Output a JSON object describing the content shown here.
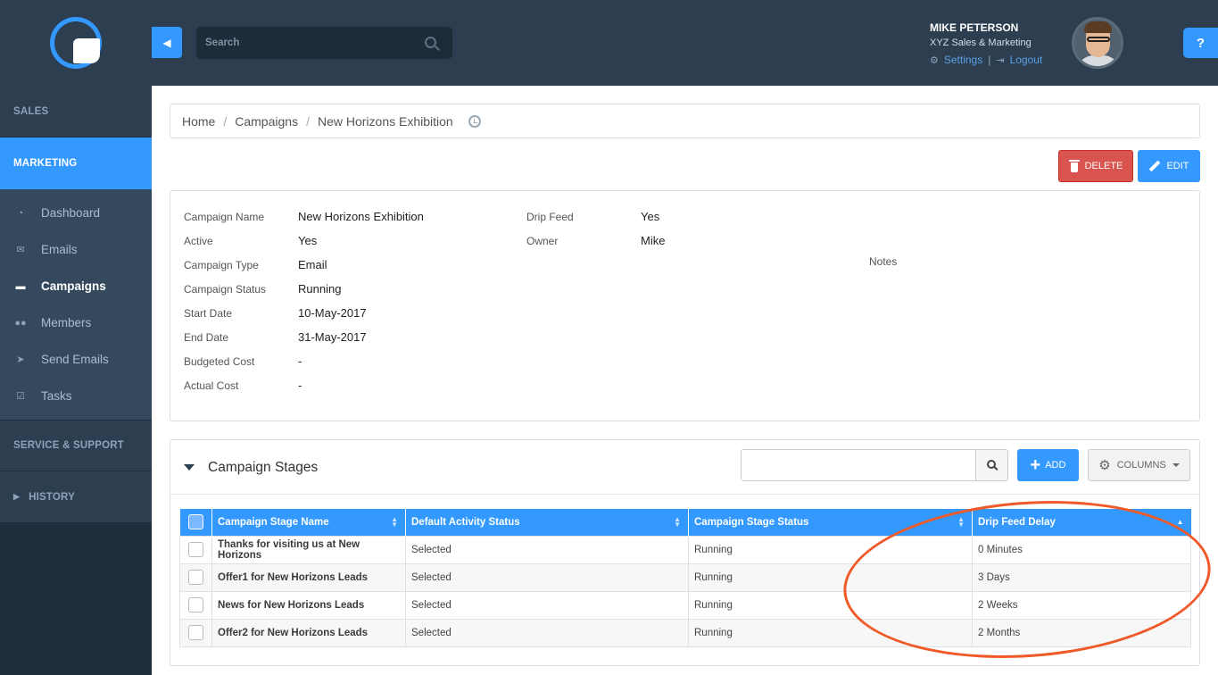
{
  "sidebar": {
    "sections": {
      "sales": "SALES",
      "marketing": "MARKETING",
      "service": "SERVICE & SUPPORT",
      "history": "HISTORY"
    },
    "marketing_items": [
      {
        "label": "Dashboard",
        "icon": "dashboard-icon"
      },
      {
        "label": "Emails",
        "icon": "envelope-icon"
      },
      {
        "label": "Campaigns",
        "icon": "inbox-icon"
      },
      {
        "label": "Members",
        "icon": "users-icon"
      },
      {
        "label": "Send Emails",
        "icon": "paper-plane-icon"
      },
      {
        "label": "Tasks",
        "icon": "check-square-icon"
      }
    ],
    "current": "Campaigns"
  },
  "topbar": {
    "search_placeholder": "Search",
    "user": {
      "name": "MIKE PETERSON",
      "company": "XYZ Sales & Marketing",
      "settings": "Settings",
      "logout": "Logout"
    },
    "help": "?"
  },
  "breadcrumb": [
    "Home",
    "Campaigns",
    "New Horizons Exhibition"
  ],
  "actions": {
    "delete": "DELETE",
    "edit": "EDIT"
  },
  "details": {
    "left": [
      {
        "label": "Campaign Name",
        "value": "New Horizons Exhibition"
      },
      {
        "label": "Active",
        "value": "Yes"
      },
      {
        "label": "Campaign Type",
        "value": "Email"
      },
      {
        "label": "Campaign Status",
        "value": "Running"
      },
      {
        "label": "Start Date",
        "value": "10-May-2017"
      },
      {
        "label": "End Date",
        "value": "31-May-2017"
      },
      {
        "label": "Budgeted Cost",
        "value": "-"
      },
      {
        "label": "Actual Cost",
        "value": "-"
      }
    ],
    "right": [
      {
        "label": "Drip Feed",
        "value": "Yes"
      },
      {
        "label": "Owner",
        "value": "Mike"
      }
    ],
    "notes_label": "Notes"
  },
  "stages": {
    "title": "Campaign Stages",
    "add": "ADD",
    "columns": "COLUMNS",
    "headers": [
      "Campaign Stage Name",
      "Default Activity Status",
      "Campaign Stage Status",
      "Drip Feed Delay"
    ],
    "rows": [
      {
        "name": "Thanks for visiting us at New Horizons",
        "activity": "Selected",
        "status": "Running",
        "delay": "0 Minutes"
      },
      {
        "name": "Offer1 for New Horizons Leads",
        "activity": "Selected",
        "status": "Running",
        "delay": "3 Days"
      },
      {
        "name": "News for New Horizons Leads",
        "activity": "Selected",
        "status": "Running",
        "delay": "2 Weeks"
      },
      {
        "name": "Offer2 for New Horizons Leads",
        "activity": "Selected",
        "status": "Running",
        "delay": "2 Months"
      }
    ]
  },
  "colors": {
    "accent": "#3399ff",
    "danger": "#d9534f",
    "sidebar": "#2c3e50",
    "highlight": "#f05a28"
  }
}
